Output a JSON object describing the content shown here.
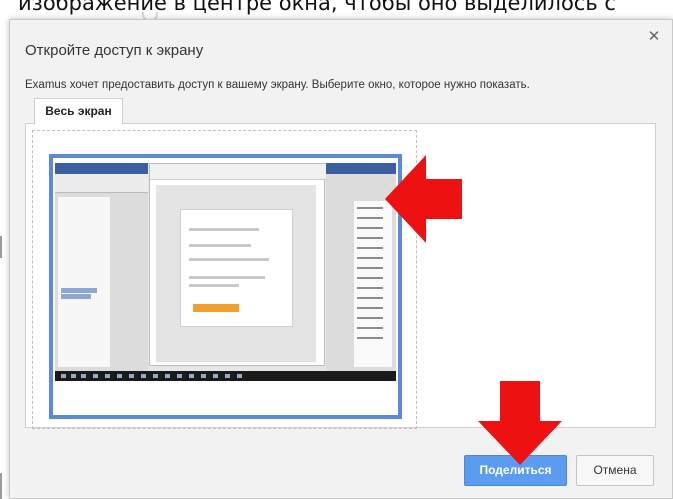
{
  "background": {
    "caption": "изображение в центре окна, чтобы оно выделилось с"
  },
  "dialog": {
    "title": "Откройте доступ к экрану",
    "description": "Examus хочет предоставить доступ к вашему экрану. Выберите окно, которое нужно показать.",
    "tabs": [
      {
        "label": "Весь экран",
        "selected": true
      }
    ],
    "close_icon": "close-icon",
    "buttons": {
      "share_label": "Поделиться",
      "cancel_label": "Отмена"
    }
  },
  "colors": {
    "accent": "#5b9bf0",
    "selection_border": "#5b8ad8",
    "arrow": "#ee1111"
  }
}
